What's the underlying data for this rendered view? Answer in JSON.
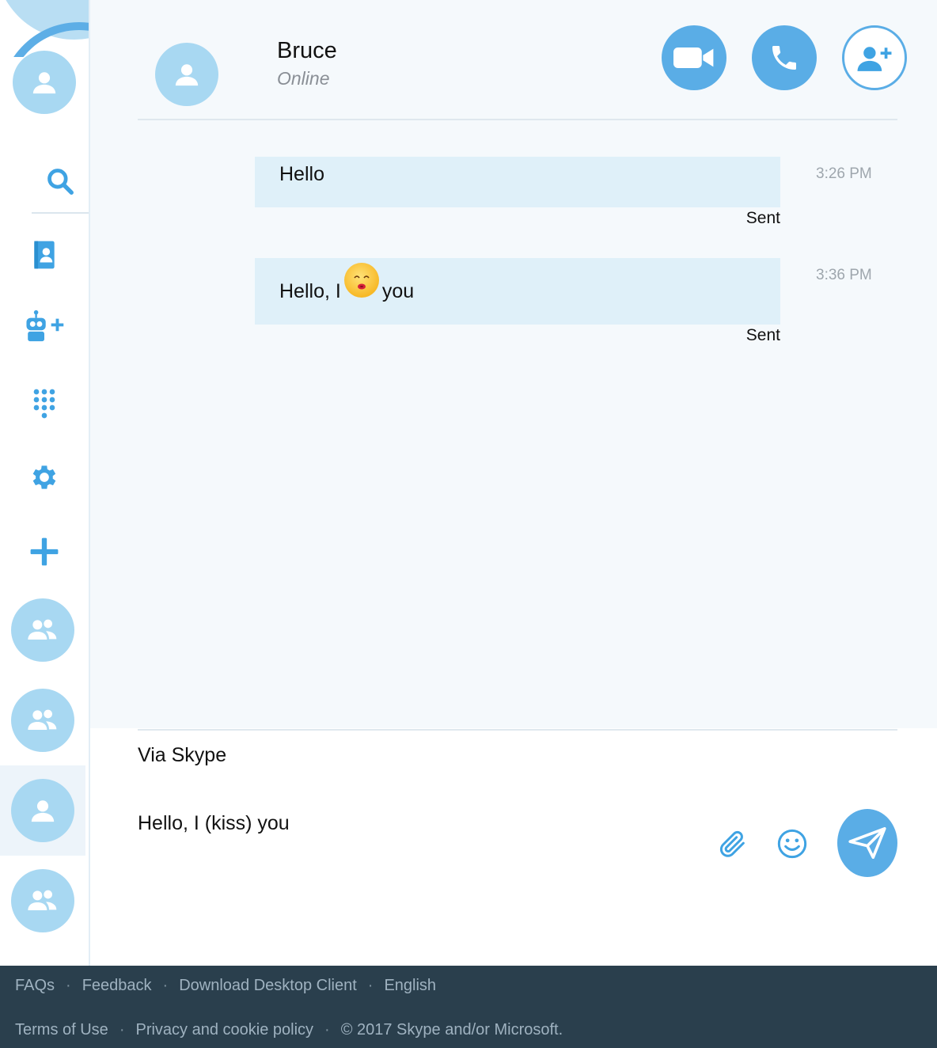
{
  "sidebar": {
    "icons": [
      "search-icon",
      "contacts-icon",
      "add-bot-icon",
      "dialpad-icon",
      "settings-icon",
      "add-icon"
    ],
    "conversations": [
      {
        "type": "group",
        "active": false
      },
      {
        "type": "group",
        "active": false
      },
      {
        "type": "person",
        "active": true
      },
      {
        "type": "group",
        "active": false
      }
    ]
  },
  "header": {
    "name": "Bruce",
    "status": "Online",
    "actions": [
      "video-call",
      "audio-call",
      "add-participant"
    ]
  },
  "messages": [
    {
      "text": "Hello",
      "time": "3:26 PM",
      "status": "Sent"
    },
    {
      "text_before": "Hello, I",
      "emoji": "kiss",
      "text_after": "you",
      "time": "3:36 PM",
      "status": "Sent"
    }
  ],
  "compose": {
    "via": "Via Skype",
    "value": "Hello, I (kiss) you"
  },
  "footer": {
    "row1": [
      "FAQs",
      "Feedback",
      "Download Desktop Client",
      "English"
    ],
    "row2": [
      "Terms of Use",
      "Privacy and cookie policy",
      "© 2017 Skype and/or Microsoft."
    ],
    "separator": "·"
  },
  "colors": {
    "accent": "#5aade6",
    "avatar": "#a8d8f2",
    "bubble": "#dff0f9",
    "footer": "#2a3f4d"
  }
}
